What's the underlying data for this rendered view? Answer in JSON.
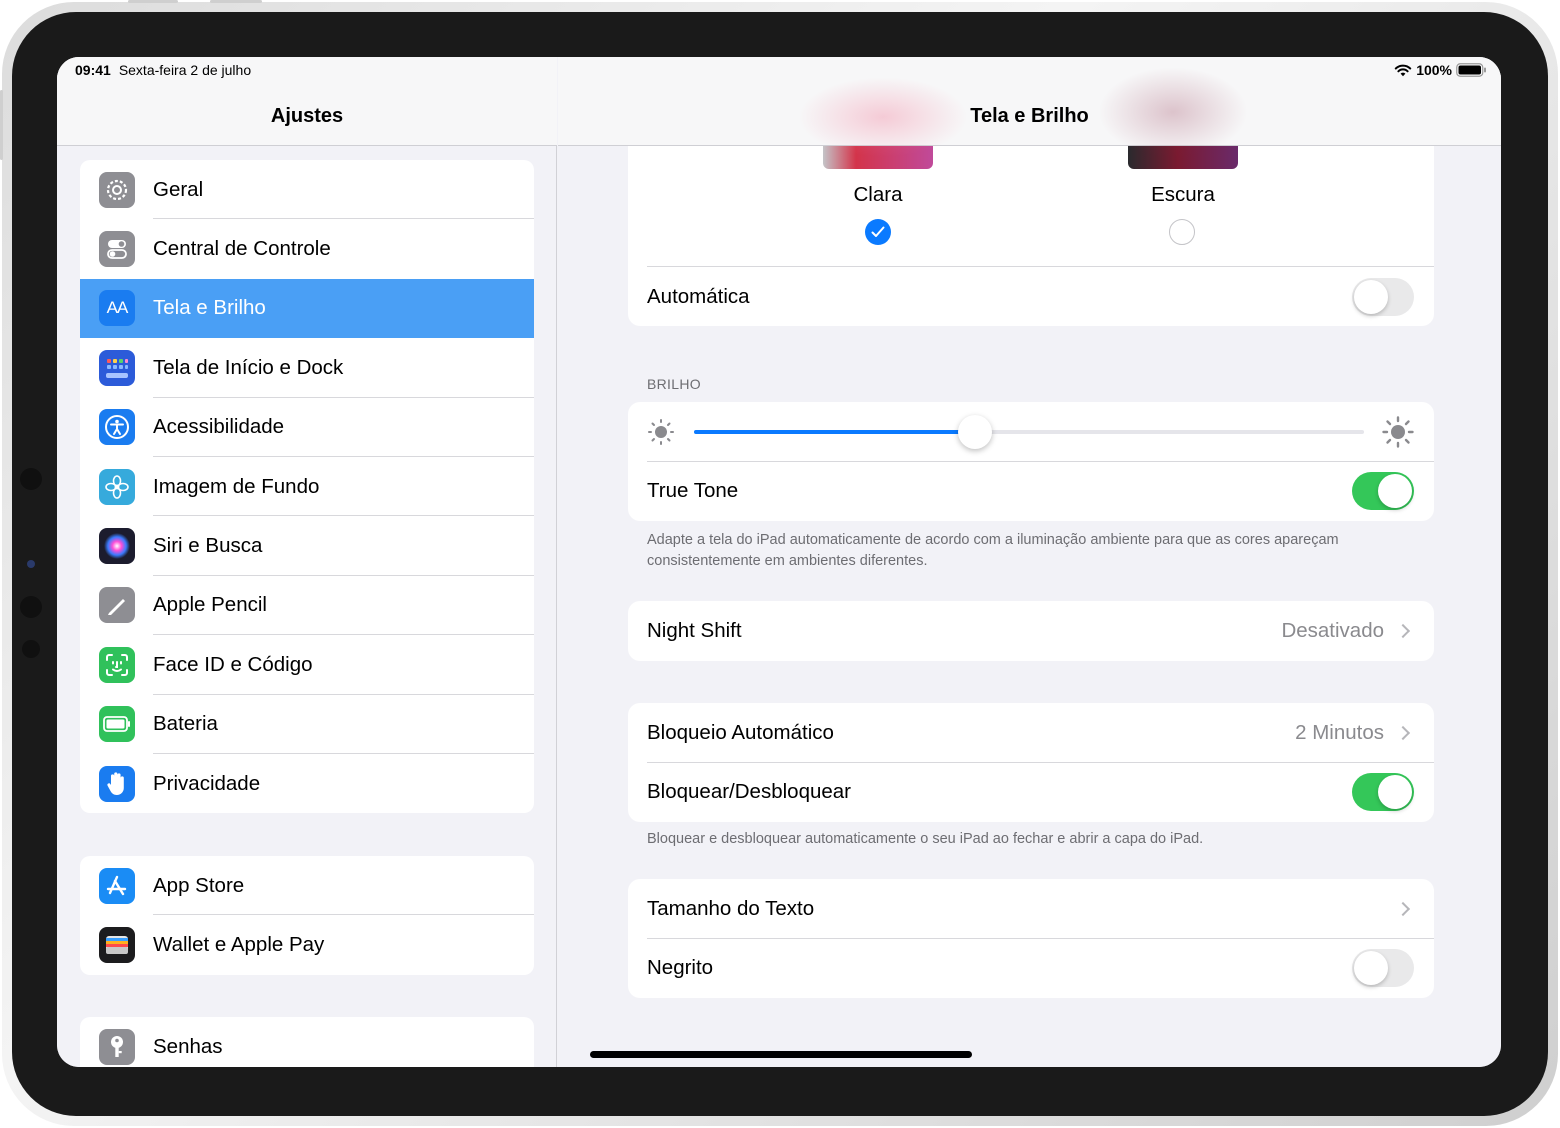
{
  "status_bar": {
    "time": "09:41",
    "date": "Sexta-feira 2 de julho",
    "battery": "100%"
  },
  "sidebar": {
    "title": "Ajustes",
    "groups": [
      [
        {
          "label": "Geral",
          "icon": "gear-icon",
          "color": "#8e8e93"
        },
        {
          "label": "Central de Controle",
          "icon": "switches-icon",
          "color": "#8e8e93"
        },
        {
          "label": "Tela e Brilho",
          "icon": "text-size-icon",
          "color": "#1a7cf0",
          "selected": true
        },
        {
          "label": "Tela de Início e Dock",
          "icon": "home-grid-icon",
          "color": "#2c5bd9"
        },
        {
          "label": "Acessibilidade",
          "icon": "accessibility-icon",
          "color": "#1a7cf0"
        },
        {
          "label": "Imagem de Fundo",
          "icon": "flower-icon",
          "color": "#36aadc"
        },
        {
          "label": "Siri e Busca",
          "icon": "siri-icon",
          "color": "#1c1c2e"
        },
        {
          "label": "Apple Pencil",
          "icon": "pencil-icon",
          "color": "#8e8e93"
        },
        {
          "label": "Face ID e Código",
          "icon": "face-id-icon",
          "color": "#30c15b"
        },
        {
          "label": "Bateria",
          "icon": "battery-icon",
          "color": "#30c15b"
        },
        {
          "label": "Privacidade",
          "icon": "hand-icon",
          "color": "#1a7cf0"
        }
      ],
      [
        {
          "label": "App Store",
          "icon": "app-store-icon",
          "color": "#1a8cf5"
        },
        {
          "label": "Wallet e Apple Pay",
          "icon": "wallet-icon",
          "color": "#1c1c1e"
        }
      ],
      [
        {
          "label": "Senhas",
          "icon": "key-icon",
          "color": "#8e8e93"
        }
      ]
    ]
  },
  "detail": {
    "title": "Tela e Brilho",
    "appearance": {
      "light_label": "Clara",
      "dark_label": "Escura",
      "selected": "Clara",
      "automatic_label": "Automática",
      "automatic_on": false
    },
    "brightness": {
      "section_label": "BRILHO",
      "level": 0.42,
      "true_tone_label": "True Tone",
      "true_tone_on": true,
      "footnote": "Adapte a tela do iPad automaticamente de acordo com a iluminação ambiente para que as cores apareçam consistentemente em ambientes diferentes."
    },
    "night_shift": {
      "label": "Night Shift",
      "value": "Desativado"
    },
    "lock": {
      "auto_lock_label": "Bloqueio Automático",
      "auto_lock_value": "2 Minutos",
      "lock_unlock_label": "Bloquear/Desbloquear",
      "lock_unlock_on": true,
      "footnote": "Bloquear e desbloquear automaticamente o seu iPad ao fechar e abrir a capa do iPad."
    },
    "text": {
      "text_size_label": "Tamanho do Texto",
      "bold_label": "Negrito",
      "bold_on": false
    }
  },
  "colors": {
    "accent": "#0a7aff",
    "toggle_on": "#34c759",
    "selected_row": "#4a9ff5"
  }
}
